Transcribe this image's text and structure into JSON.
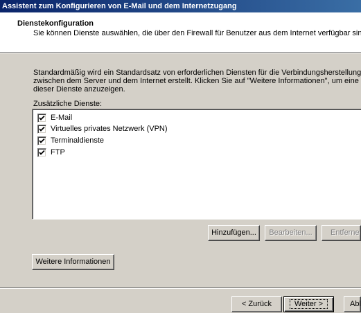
{
  "window": {
    "title": "Assistent zum Konfigurieren von E-Mail und dem Internetzugang"
  },
  "header": {
    "title": "Dienstekonfiguration",
    "subtitle": "Sie können Dienste auswählen, die über den Firewall für Benutzer aus dem Internet verfügbar sind."
  },
  "body": {
    "description_line1": "Standardmäßig wird ein Standardsatz von erforderlichen Diensten für die Verbindungsherstellung",
    "description_line2": "zwischen dem Server und dem Internet erstellt. Klicken Sie auf \"Weitere Informationen\", um eine Liste",
    "description_line3": "dieser Dienste anzuzeigen.",
    "services_label": "Zusätzliche Dienste:",
    "services": [
      {
        "label": "E-Mail",
        "checked": true
      },
      {
        "label": "Virtuelles privates Netzwerk (VPN)",
        "checked": true
      },
      {
        "label": "Terminaldienste",
        "checked": true
      },
      {
        "label": "FTP",
        "checked": true
      }
    ]
  },
  "buttons": {
    "add": "Hinzufügen...",
    "edit": "Bearbeiten...",
    "remove": "Entfernen",
    "more_info": "Weitere Informationen",
    "back": "< Zurück",
    "next": "Weiter >",
    "cancel": "Abbrechen"
  }
}
